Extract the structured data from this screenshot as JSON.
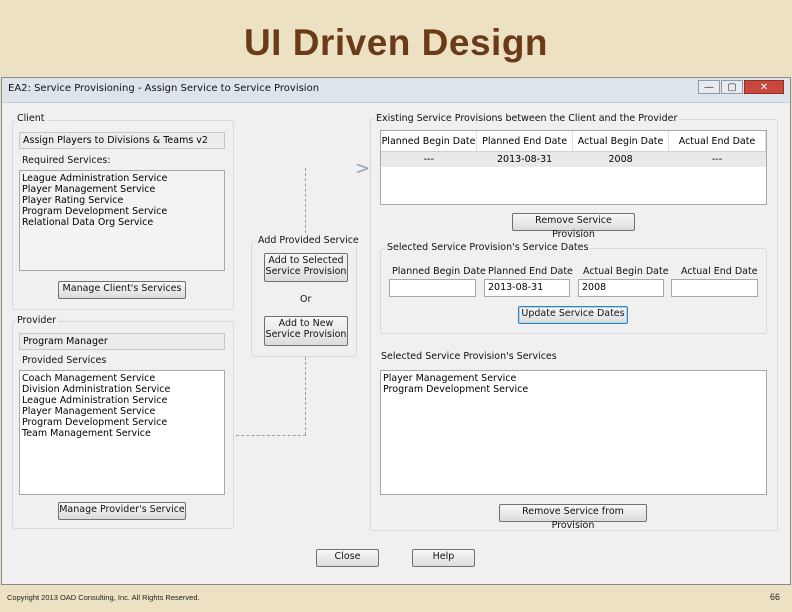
{
  "slide": {
    "title": "UI Driven Design",
    "footer": "Copyright 2013 OAD Consulting, Inc. All Rights Reserved.",
    "page_number": "66"
  },
  "window": {
    "title": "EA2: Service Provisioning - Assign Service to Service Provision",
    "controls": {
      "minimize": "—",
      "maximize": "▢",
      "close": "✕"
    }
  },
  "client": {
    "group_label": "Client",
    "name": "Assign Players to Divisions & Teams v2",
    "required_label": "Required Services:",
    "required_services": [
      "League Administration Service",
      "Player Management Service",
      "Player Rating Service",
      "Program Development Service",
      "Relational Data Org Service"
    ],
    "manage_button": "Manage Client's Services"
  },
  "provider": {
    "group_label": "Provider",
    "name": "Program Manager",
    "provided_label": "Provided Services",
    "provided_services": [
      "Coach Management Service",
      "Division Administration Service",
      "League Administration Service",
      "Player Management Service",
      "Program Development Service",
      "Team Management Service"
    ],
    "manage_button": "Manage Provider's Service"
  },
  "add_service": {
    "group_label": "Add Provided Service",
    "add_to_selected_line1": "Add to Selected",
    "add_to_selected_line2": "Service Provision",
    "or_label": "Or",
    "add_to_new_line1": "Add to New",
    "add_to_new_line2": "Service Provision",
    "arrow": ">"
  },
  "existing": {
    "group_label": "Existing Service Provisions between the Client and the Provider",
    "columns": [
      "Planned Begin Date",
      "Planned End Date",
      "Actual Begin Date",
      "Actual End Date"
    ],
    "rows": [
      [
        "---",
        "2013-08-31",
        "2008",
        "---"
      ]
    ],
    "remove_button": "Remove Service Provision"
  },
  "dates": {
    "group_label": "Selected Service Provision's Service Dates",
    "labels": [
      "Planned Begin Date",
      "Planned End Date",
      "Actual Begin Date",
      "Actual End Date"
    ],
    "values": [
      "",
      "2013-08-31",
      "2008",
      ""
    ],
    "update_button": "Update Service Dates"
  },
  "selected_services": {
    "label": "Selected Service Provision's Services",
    "items": [
      "Player Management Service",
      "Program Development Service"
    ],
    "remove_button": "Remove Service from Provision"
  },
  "bottom": {
    "close_button": "Close",
    "help_button": "Help"
  }
}
